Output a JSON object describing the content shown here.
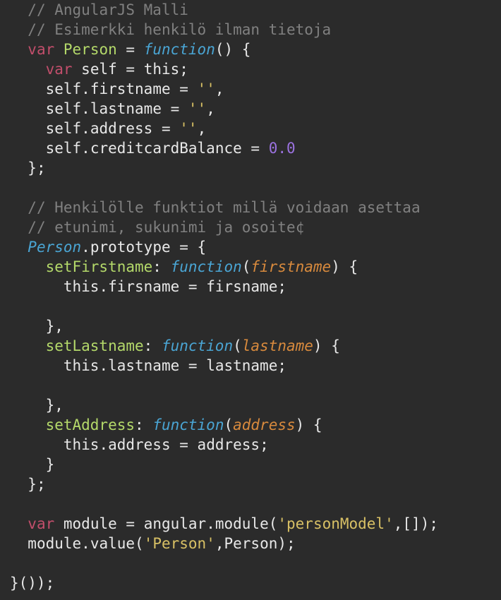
{
  "code": {
    "comment1": "// AngularJS Malli",
    "comment2": "// Esimerkki henkilö ilman tietoja",
    "kw_var": "var",
    "Person": "Person",
    "equals": " = ",
    "kw_function": "function",
    "fn_parens_open_brace": "() {",
    "l4_self": "self",
    "l4_this": "this",
    "l4_semi": ";",
    "firstname": "firstname",
    "lastname": "lastname",
    "address": "address",
    "creditcardBalance": "creditcardBalance",
    "emptystr": "''",
    "comma": ",",
    "zero": "0.0",
    "close_brace_semi": "};",
    "comment3": "// Henkilölle funktiot millä voidaan asettaa",
    "comment4": "// etunimi, sukunimi ja osoite¢",
    "prototype": "prototype",
    "setFirstname": "setFirstname",
    "setLastname": "setLastname",
    "setAddress": "setAddress",
    "p_firstname": "firstname",
    "p_lastname": "lastname",
    "p_address": "address",
    "this_firsname": "firsname",
    "this_lastname": "lastname",
    "this_address": "address",
    "rhs_firsname": "firsname",
    "rhs_lastname": "lastname",
    "rhs_address": "address",
    "close_brace_comma": "},",
    "close_brace": "}",
    "module_var": "module",
    "angular": "angular",
    "module_fn": "module",
    "personModel": "'personModel'",
    "emptyarr": "[]",
    "value_fn": "value",
    "PersonStr": "'Person'",
    "iife_end": "}());",
    "this": "this",
    "self": "self",
    "colon_sp": ": ",
    "dot": ".",
    "open_paren": "(",
    "close_paren_brace": ") {",
    "close_paren_semi": ");",
    "close_paren": ")",
    "semi": ";",
    "assign": " = ",
    "indent2": "  ",
    "indent4": "    ",
    "indent6": "      "
  }
}
